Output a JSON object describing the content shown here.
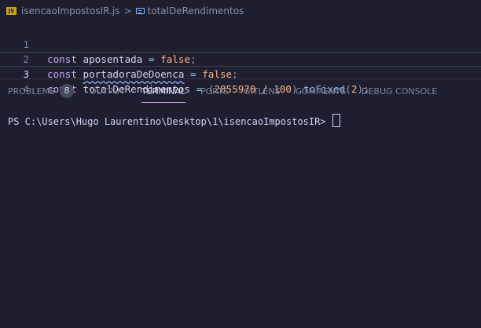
{
  "breadcrumb": {
    "file_icon_label": "JS",
    "file_name": "isencaoImpostosIR.js",
    "separator": ">",
    "symbol": "totalDeRendimentos"
  },
  "editor": {
    "lines": [
      {
        "number": "1",
        "kw": "const",
        "name": "aposentada",
        "op": "=",
        "value": "false",
        "end": ";"
      },
      {
        "number": "2",
        "kw": "const",
        "name": "portadoraDeDoenca",
        "op": "=",
        "value": "false",
        "end": ";"
      },
      {
        "number": "3",
        "kw": "const",
        "name": "totalDeRendimentos",
        "op": "=",
        "open": "(",
        "num1": "2855970",
        "div": "/",
        "num2": "100",
        "close": ")",
        "dot": ".",
        "method": "toFixed",
        "argopen": "(",
        "arg": "2",
        "argclose": ")",
        "end": ";"
      },
      {
        "number": "4"
      }
    ]
  },
  "panel": {
    "tabs": [
      {
        "label": "PROBLEMS",
        "badge": "8"
      },
      {
        "label": "OUTPUT"
      },
      {
        "label": "TERMINAL",
        "active": true
      },
      {
        "label": "PORTS"
      },
      {
        "label": "GITLENS"
      },
      {
        "label": "COMMENTS"
      },
      {
        "label": "DEBUG CONSOLE"
      }
    ]
  },
  "terminal": {
    "prompt": "PS C:\\Users\\Hugo Laurentino\\Desktop\\1\\isencaoImpostosIR> "
  },
  "colors": {
    "background": "#1e1e2e",
    "keyword": "#cba6f7",
    "boolean": "#fab387",
    "method": "#89b4fa",
    "active_tab_underline": "#cba6f7"
  }
}
